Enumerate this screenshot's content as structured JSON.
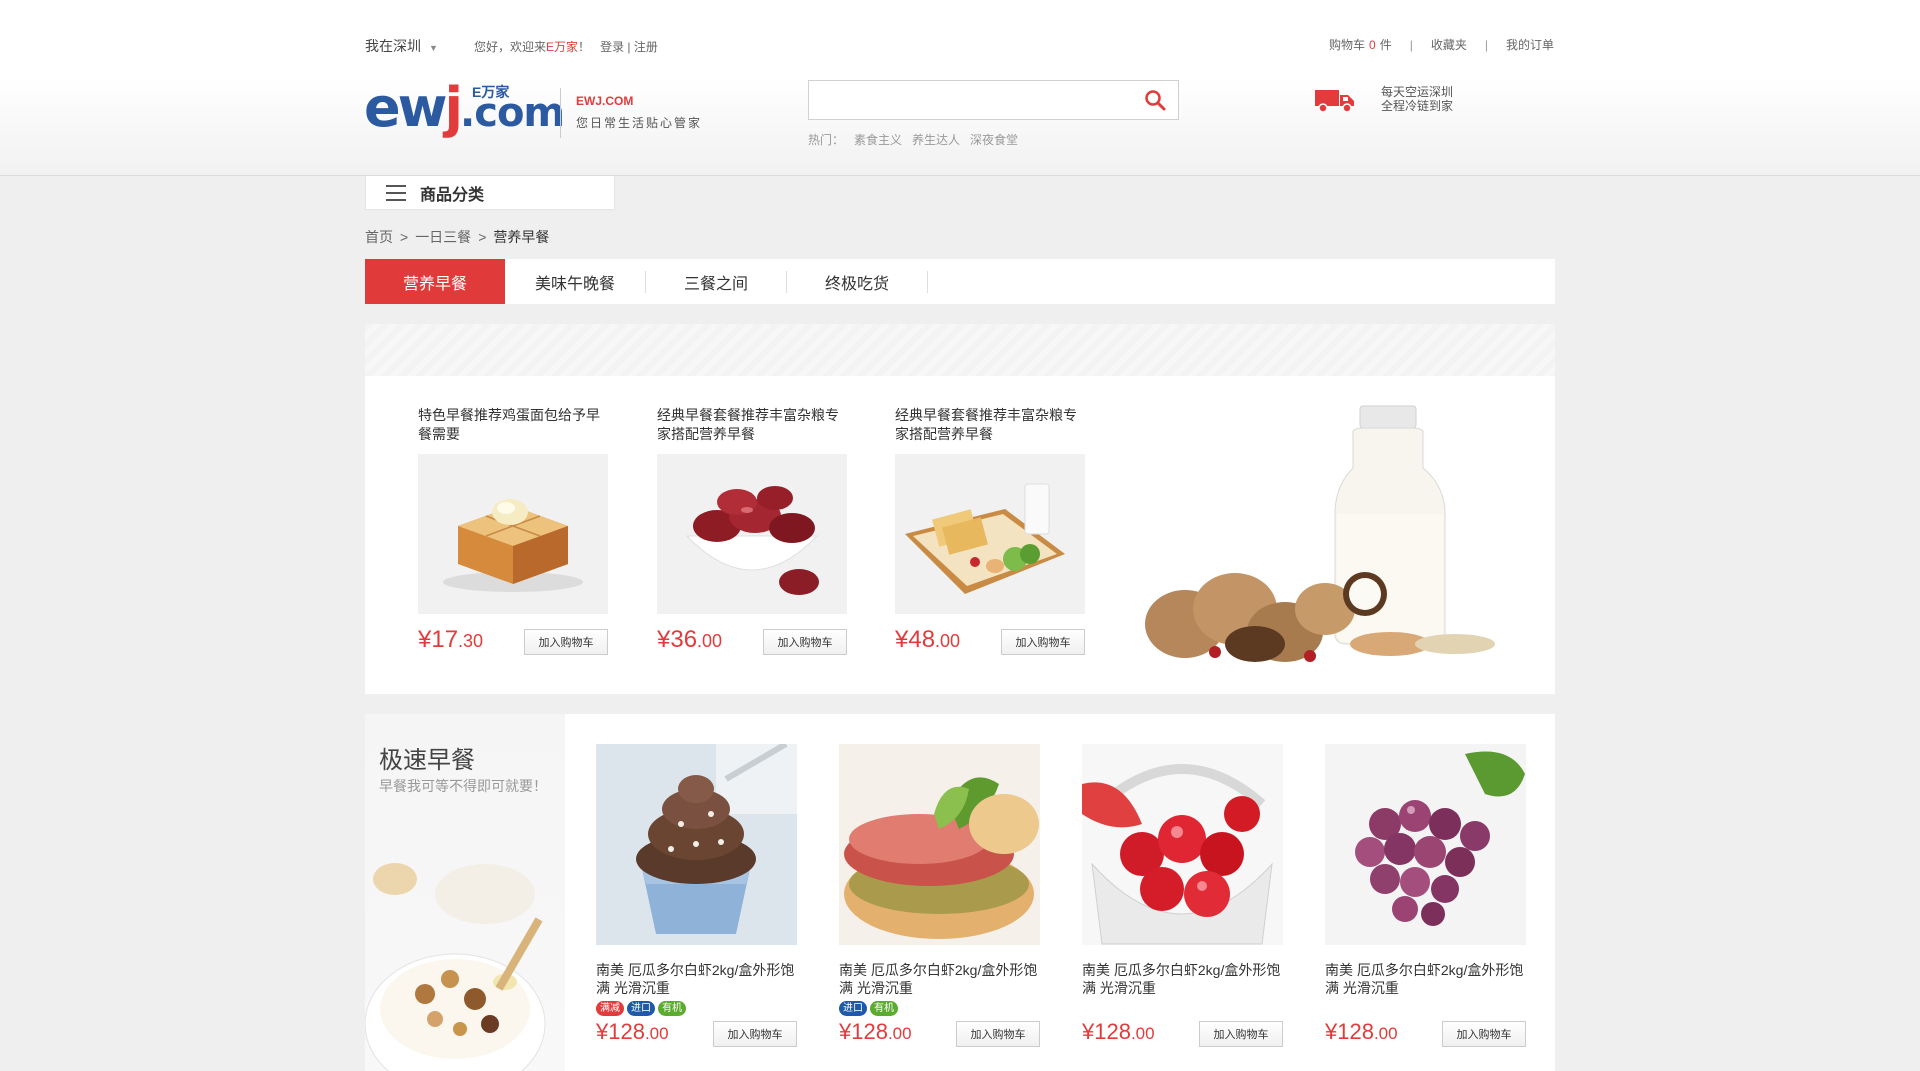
{
  "topbar": {
    "city": "我在深圳",
    "welcome_prefix": "您好，欢迎来",
    "welcome_brand": "E万家",
    "welcome_suffix": "！",
    "login": "登录",
    "login_sep": "|",
    "register": "注册",
    "cart_label": "购物车",
    "cart_count": "0",
    "cart_unit": "件",
    "favorites": "收藏夹",
    "orders": "我的订单",
    "sep": "|"
  },
  "logo": {
    "letters_e": "e",
    "letters_w": "w",
    "letters_j": "j",
    "dot_com": ".com",
    "cn": "E万家",
    "en": "EWJ.COM",
    "slogan": "您日常生活贴心管家"
  },
  "search": {
    "value": "",
    "placeholder": "",
    "hot_label": "热门：",
    "hot_items": [
      "素食主义",
      "养生达人",
      "深夜食堂"
    ]
  },
  "delivery": {
    "line1": "每天空运深圳",
    "line2": "全程冷链到家"
  },
  "category": {
    "label": "商品分类"
  },
  "breadcrumb": {
    "items": [
      "首页",
      "一日三餐",
      "营养早餐"
    ],
    "sep": ">"
  },
  "tabs": [
    "营养早餐",
    "美味午晚餐",
    "三餐之间",
    "终极吃货"
  ],
  "featured": {
    "items": [
      {
        "title": "特色早餐推荐鸡蛋面包给予早餐需要",
        "price_int": "¥17",
        "price_dec": ".30",
        "add": "加入购物车"
      },
      {
        "title": "经典早餐套餐推荐丰富杂粮专家搭配营养早餐",
        "price_int": "¥36",
        "price_dec": ".00",
        "add": "加入购物车"
      },
      {
        "title": "经典早餐套餐推荐丰富杂粮专家搭配营养早餐",
        "price_int": "¥48",
        "price_dec": ".00",
        "add": "加入购物车"
      }
    ]
  },
  "quick": {
    "title": "极速早餐",
    "subtitle": "早餐我可等不得即可就要！",
    "items": [
      {
        "title": "南美 厄瓜多尔白虾2kg/盒外形饱满 光滑沉重",
        "tags": [
          "满减",
          "进口",
          "有机"
        ],
        "price_int": "¥128",
        "price_dec": ".00",
        "add": "加入购物车"
      },
      {
        "title": "南美 厄瓜多尔白虾2kg/盒外形饱满 光滑沉重",
        "tags": [
          "进口",
          "有机"
        ],
        "price_int": "¥128",
        "price_dec": ".00",
        "add": "加入购物车"
      },
      {
        "title": "南美 厄瓜多尔白虾2kg/盒外形饱满 光滑沉重",
        "tags": [],
        "price_int": "¥128",
        "price_dec": ".00",
        "add": "加入购物车"
      },
      {
        "title": "南美 厄瓜多尔白虾2kg/盒外形饱满 光滑沉重",
        "tags": [],
        "price_int": "¥128",
        "price_dec": ".00",
        "add": "加入购物车"
      }
    ]
  },
  "colors": {
    "accent": "#e13a3a",
    "brand_blue": "#2b5aa0",
    "tag_red": "#e23b3b",
    "tag_blue": "#1f5aa8",
    "tag_green": "#5bab2f"
  }
}
